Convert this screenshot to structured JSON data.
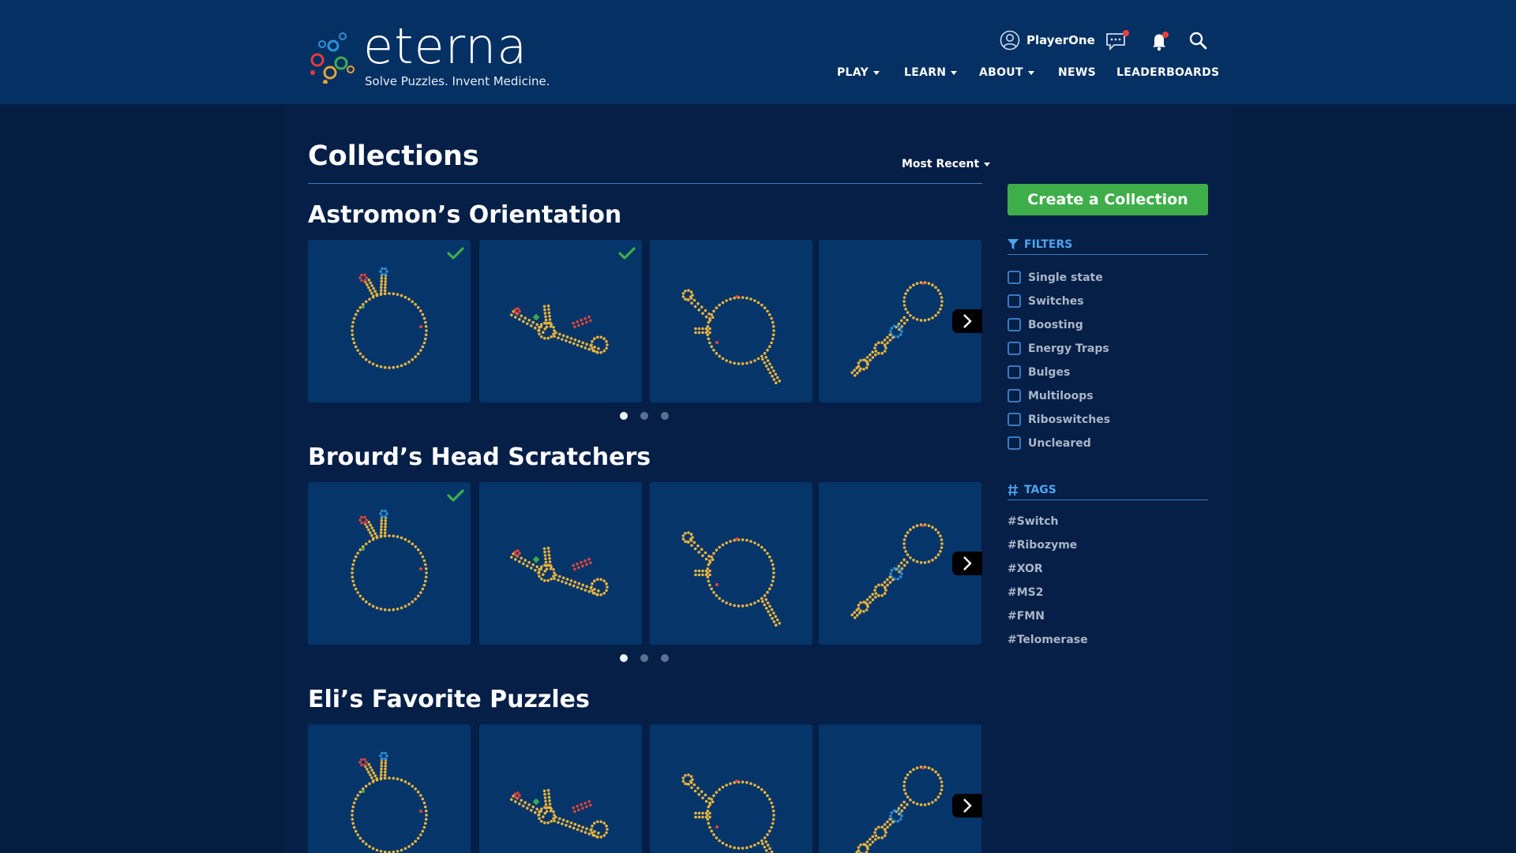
{
  "header": {
    "logo_text": "eterna",
    "tagline": "Solve Puzzles. Invent Medicine.",
    "username": "PlayerOne",
    "nav": [
      {
        "label": "PLAY",
        "dropdown": true
      },
      {
        "label": "LEARN",
        "dropdown": true
      },
      {
        "label": "ABOUT",
        "dropdown": true
      },
      {
        "label": "NEWS",
        "dropdown": false
      },
      {
        "label": "LEADERBOARDS",
        "dropdown": false
      }
    ],
    "icons": [
      "user-icon",
      "chat-icon",
      "bell-icon",
      "search-icon"
    ]
  },
  "main": {
    "title": "Collections",
    "sort_label": "Most Recent",
    "collections": [
      {
        "title": "Astromon’s Orientation",
        "completed": [
          true,
          true,
          false,
          false
        ],
        "active_page": 1,
        "pages": 3
      },
      {
        "title": "Brourd’s Head Scratchers",
        "completed": [
          true,
          false,
          false,
          false
        ],
        "active_page": 1,
        "pages": 3
      },
      {
        "title": "Eli’s Favorite Puzzles",
        "completed": [
          false,
          false,
          false,
          false
        ],
        "active_page": 1,
        "pages": 3
      }
    ]
  },
  "sidebar": {
    "create_label": "Create a Collection",
    "filters_label": "FILTERS",
    "filters": [
      "Single state",
      "Switches",
      "Boosting",
      "Energy Traps",
      "Bulges",
      "Multiloops",
      "Riboswitches",
      "Uncleared"
    ],
    "tags_label": "TAGS",
    "tags": [
      "#Switch",
      "#Ribozyme",
      "#XOR",
      "#MS2",
      "#FMN",
      "#Telomerase"
    ]
  },
  "colors": {
    "header_bg": "#043063",
    "page_bg": "#061d42",
    "card_bg": "#06356a",
    "accent_blue": "#4ea4ef",
    "create_green": "#3dae49",
    "check_green": "#3dae49"
  }
}
